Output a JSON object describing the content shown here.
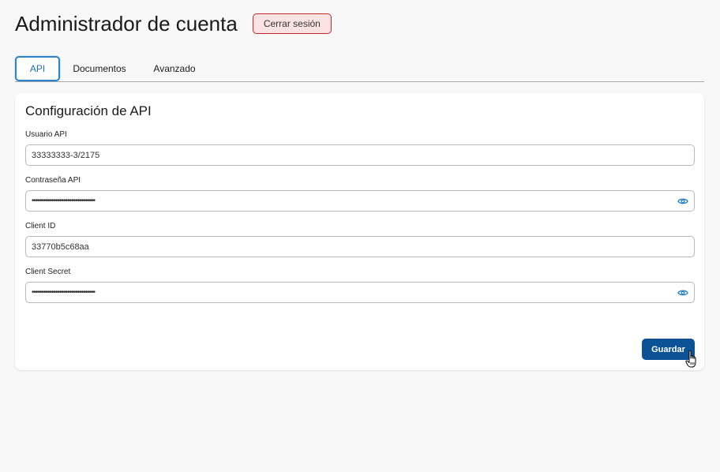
{
  "header": {
    "title": "Administrador de cuenta",
    "logout_label": "Cerrar sesión"
  },
  "tabs": [
    {
      "label": "API",
      "active": true
    },
    {
      "label": "Documentos",
      "active": false
    },
    {
      "label": "Avanzado",
      "active": false
    }
  ],
  "card": {
    "title": "Configuración de API",
    "fields": {
      "usuario": {
        "label": "Usuario API",
        "value": "33333333-3/2175"
      },
      "password": {
        "label": "Contraseña API",
        "value": "••••••••••••••••••••••••••••••••"
      },
      "client_id": {
        "label": "Client ID",
        "value": "33770b5c68aa"
      },
      "client_secret": {
        "label": "Client Secret",
        "value": "••••••••••••••••••••••••••••••••"
      }
    },
    "save_label": "Guardar"
  },
  "colors": {
    "accent": "#2d84c8",
    "primary_button": "#0d5294",
    "logout_bg": "#fbe3e4",
    "logout_border": "#c62828"
  },
  "icons": {
    "toggle_visibility": "eye-icon",
    "mouse_pointer": "hand-cursor-icon"
  }
}
